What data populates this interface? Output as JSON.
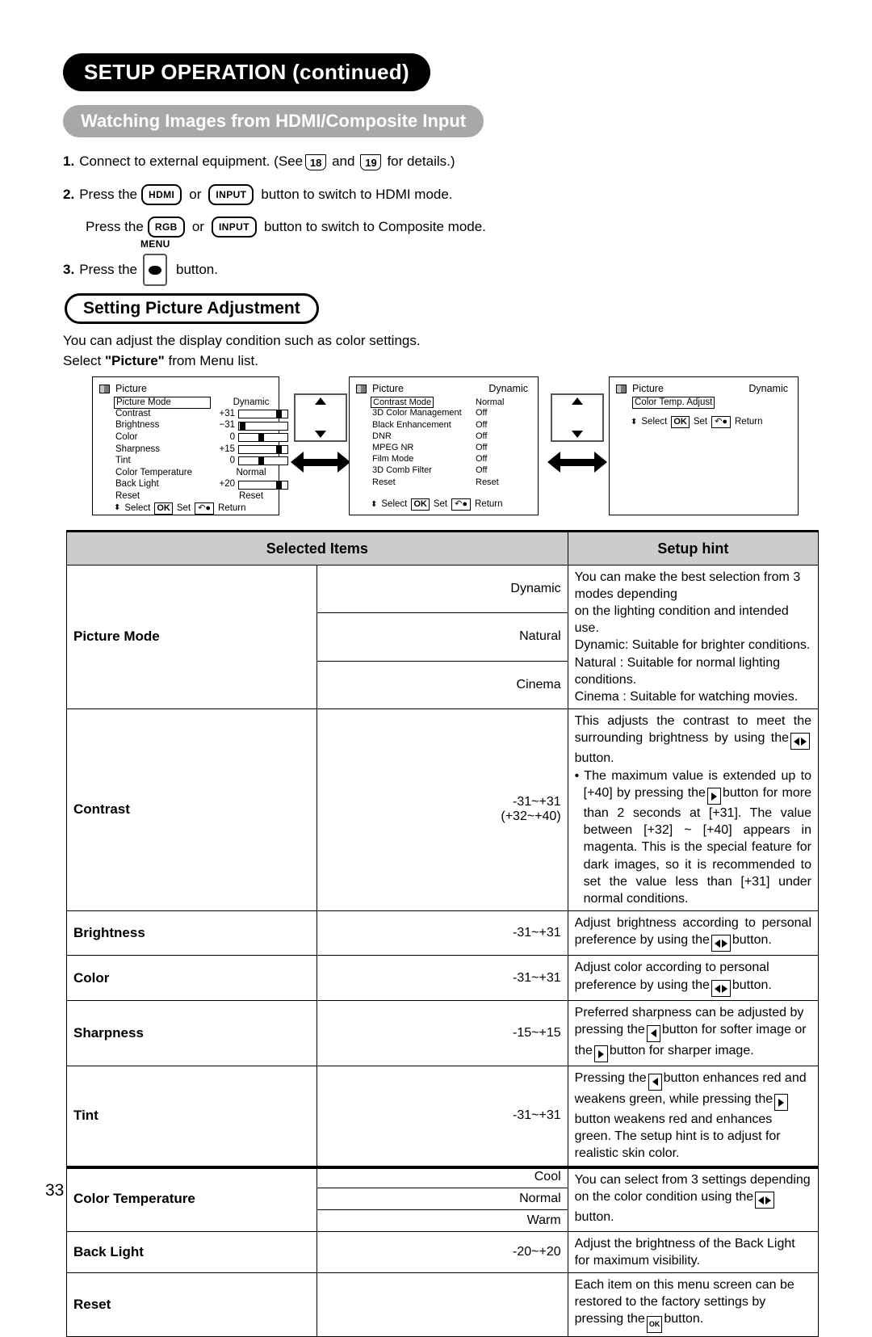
{
  "header": {
    "title": "SETUP OPERATION (continued)",
    "subtitle": "Watching Images from HDMI/Composite Input"
  },
  "steps": [
    {
      "num": "1.",
      "pre": "Connect to external equipment. (See",
      "ref1": "18",
      "mid": "and",
      "ref2": "19",
      "post": "for details.)"
    },
    {
      "num": "2.",
      "pre": "Press the",
      "key1": "HDMI",
      "mid": "or",
      "key2": "INPUT",
      "post": "button to switch to HDMI mode."
    },
    {
      "num": "",
      "pre": "Press the",
      "key1": "RGB",
      "mid": "or",
      "key2": "INPUT",
      "post": "button to switch to Composite mode."
    },
    {
      "num": "3.",
      "pre": "Press the",
      "key_label": "MENU",
      "post": "button."
    }
  ],
  "section": {
    "heading": "Setting Picture Adjustment",
    "line1": "You can adjust the display condition such as color settings.",
    "line2_pre": "Select",
    "line2_bold": "\"Picture\"",
    "line2_post": "from Menu list."
  },
  "osd_nav": {
    "select": "Select",
    "ok": "OK",
    "set": "Set",
    "return": "Return"
  },
  "osd1": {
    "title": "Picture",
    "rows": [
      {
        "label": "Picture Mode",
        "value": "Dynamic",
        "type": "word",
        "selected": true
      },
      {
        "label": "Contrast",
        "value": "+31",
        "type": "bar",
        "fill": 88
      },
      {
        "label": "Brightness",
        "value": "−31",
        "type": "bar",
        "fill": 2
      },
      {
        "label": "Color",
        "value": "0",
        "type": "bar",
        "fill": 46
      },
      {
        "label": "Sharpness",
        "value": "+15",
        "type": "bar",
        "fill": 88
      },
      {
        "label": "Tint",
        "value": "0",
        "type": "bar",
        "fill": 46
      },
      {
        "label": "Color Temperature",
        "value": "Normal",
        "type": "word"
      },
      {
        "label": "Back Light",
        "value": "+20",
        "type": "bar",
        "fill": 88
      },
      {
        "label": "Reset",
        "value": "Reset",
        "type": "word"
      }
    ]
  },
  "osd2": {
    "title": "Picture",
    "title_value": "Dynamic",
    "rows": [
      {
        "label": "Contrast Mode",
        "value": "Normal",
        "selected": true
      },
      {
        "label": "3D Color Management",
        "value": "Off"
      },
      {
        "label": "Black Enhancement",
        "value": "Off"
      },
      {
        "label": "DNR",
        "value": "Off"
      },
      {
        "label": "MPEG NR",
        "value": "Off"
      },
      {
        "label": "Film Mode",
        "value": "Off"
      },
      {
        "label": "3D Comb Filter",
        "value": "Off"
      },
      {
        "label": "Reset",
        "value": "Reset"
      }
    ]
  },
  "osd3": {
    "title": "Picture",
    "title_value": "Dynamic",
    "rows": [
      {
        "label": "Color Temp. Adjust",
        "value": "",
        "selected": true
      }
    ]
  },
  "table": {
    "headers": {
      "col1": "Selected Items",
      "col2": "Setup hint"
    },
    "rows": [
      {
        "item": "Picture Mode",
        "options": [
          "Dynamic",
          "Natural",
          "Cinema"
        ],
        "hint_lines": [
          "You can make the best selection from 3 modes depending",
          "on the lighting condition and intended use.",
          "Dynamic: Suitable for brighter conditions.",
          "Natural  : Suitable for normal lighting conditions.",
          "Cinema  : Suitable for watching movies."
        ]
      },
      {
        "item": "Contrast",
        "range1": "-31~+31",
        "range2": "(+32~+40)",
        "hint_p1a": "This adjusts the contrast to meet the surrounding brightness by using the",
        "hint_p1b": "button.",
        "hint_p2a": "• The maximum value is extended up to [+40] by pressing the",
        "hint_p2b": "button for more than 2 seconds at [+31]. The value between [+32] ~ [+40] appears in magenta. This is the special feature for dark images, so it is recommended to set the value less than [+31] under normal conditions."
      },
      {
        "item": "Brightness",
        "range1": "-31~+31",
        "hint_a": "Adjust brightness according to personal preference by using the",
        "hint_b": "button."
      },
      {
        "item": "Color",
        "range1": "-31~+31",
        "hint_a": "Adjust color according to personal preference by using the",
        "hint_b": "button."
      },
      {
        "item": "Sharpness",
        "range1": "-15~+15",
        "hint_a": "Preferred sharpness can be adjusted by pressing the",
        "hint_b": "button for softer image or the",
        "hint_c": "button for sharper image."
      },
      {
        "item": "Tint",
        "range1": "-31~+31",
        "hint_a": "Pressing the",
        "hint_b": "button enhances red and weakens green, while pressing the",
        "hint_c": "button weakens red and enhances green. The setup hint is to adjust for realistic skin color."
      },
      {
        "item": "Color Temperature",
        "options": [
          "Cool",
          "Normal",
          "Warm"
        ],
        "hint_a": "You can select from 3 settings depending on the color condition using the",
        "hint_b": "button."
      },
      {
        "item": "Back Light",
        "range1": "-20~+20",
        "hint_a": "Adjust the brightness of the Back Light for maximum visibility."
      },
      {
        "item": "Reset",
        "range1": "",
        "hint_a": "Each item on this menu screen can be restored to the factory settings by pressing the",
        "hint_b": "button."
      }
    ]
  },
  "footer": {
    "page_number": "33"
  }
}
